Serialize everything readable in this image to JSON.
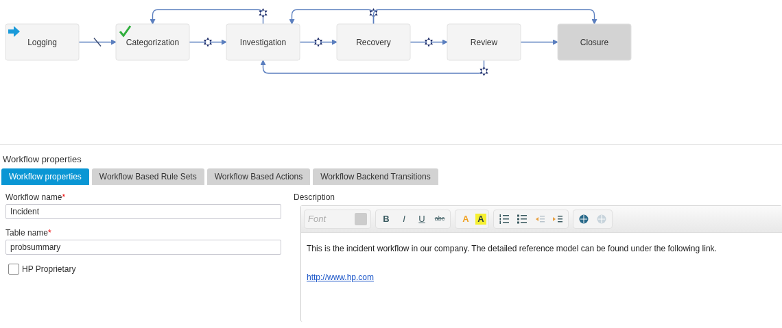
{
  "diagram": {
    "nodes": [
      {
        "label": "Logging",
        "kind": "start",
        "exits": [
          {
            "kind": "next-blocked"
          }
        ]
      },
      {
        "label": "Categorization",
        "kind": "done",
        "exits": [
          {
            "kind": "next-rule"
          }
        ]
      },
      {
        "label": "Investigation",
        "kind": "step",
        "exits": [
          {
            "kind": "next-rule"
          },
          {
            "kind": "back-rule"
          }
        ]
      },
      {
        "label": "Recovery",
        "kind": "step",
        "exits": [
          {
            "kind": "next-rule"
          },
          {
            "kind": "back-rule"
          },
          {
            "kind": "skip-ahead-rule"
          }
        ]
      },
      {
        "label": "Review",
        "kind": "step",
        "exits": [
          {
            "kind": "next"
          },
          {
            "kind": "skip-back-rule"
          }
        ]
      },
      {
        "label": "Closure",
        "kind": "end"
      }
    ]
  },
  "panel": {
    "title": "Workflow properties",
    "tabs": [
      {
        "label": "Workflow properties",
        "selected": true
      },
      {
        "label": "Workflow Based Rule Sets",
        "selected": false
      },
      {
        "label": "Workflow Based Actions",
        "selected": false
      },
      {
        "label": "Workflow Backend Transitions",
        "selected": false
      }
    ],
    "fields": [
      {
        "label": "Workflow name",
        "required_mark": "*",
        "value": "Incident"
      },
      {
        "label": "Table name",
        "required_mark": "*",
        "value": "probsummary"
      }
    ],
    "checkbox": {
      "label": "HP Proprietary",
      "checked": false
    },
    "description": {
      "label": "Description",
      "toolbar": [
        [
          {
            "kind": "font-select",
            "placeholder": "Font",
            "disabled": false
          }
        ],
        [
          {
            "kind": "bold",
            "label": "B",
            "disabled": false
          },
          {
            "kind": "italic",
            "label": "I",
            "disabled": false
          },
          {
            "kind": "underline",
            "label": "U",
            "disabled": false
          },
          {
            "kind": "strike",
            "label": "abc",
            "disabled": false
          }
        ],
        [
          {
            "kind": "font-color",
            "label": "A",
            "disabled": false
          },
          {
            "kind": "highlight",
            "label": "A",
            "disabled": false
          }
        ],
        [
          {
            "kind": "ordered-list",
            "disabled": false
          },
          {
            "kind": "bullet-list",
            "disabled": false
          },
          {
            "kind": "outdent",
            "disabled": true
          },
          {
            "kind": "indent",
            "disabled": false
          }
        ],
        [
          {
            "kind": "link",
            "disabled": false
          },
          {
            "kind": "unlink",
            "disabled": true
          }
        ]
      ],
      "text": "This is the incident workflow in our company. The detailed reference model can be found under the following link.",
      "link": "http://www.hp.com"
    }
  }
}
